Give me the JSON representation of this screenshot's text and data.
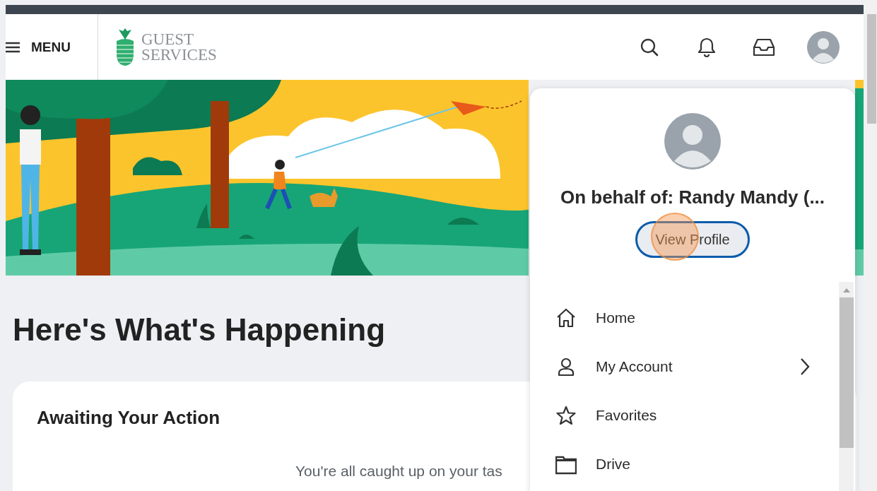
{
  "header": {
    "menu_label": "MENU",
    "logo_lines": [
      "GUEST",
      "SERVICES"
    ]
  },
  "page": {
    "heading": "Here's What's Happening",
    "card": {
      "title": "Awaiting Your Action",
      "message": "You're all caught up on your tas"
    }
  },
  "profile_menu": {
    "name": "On behalf of: Randy Mandy (...",
    "button": "View Profile",
    "items": [
      {
        "label": "Home",
        "has_submenu": false
      },
      {
        "label": "My Account",
        "has_submenu": true
      },
      {
        "label": "Favorites",
        "has_submenu": false
      },
      {
        "label": "Drive",
        "has_submenu": false
      }
    ]
  }
}
